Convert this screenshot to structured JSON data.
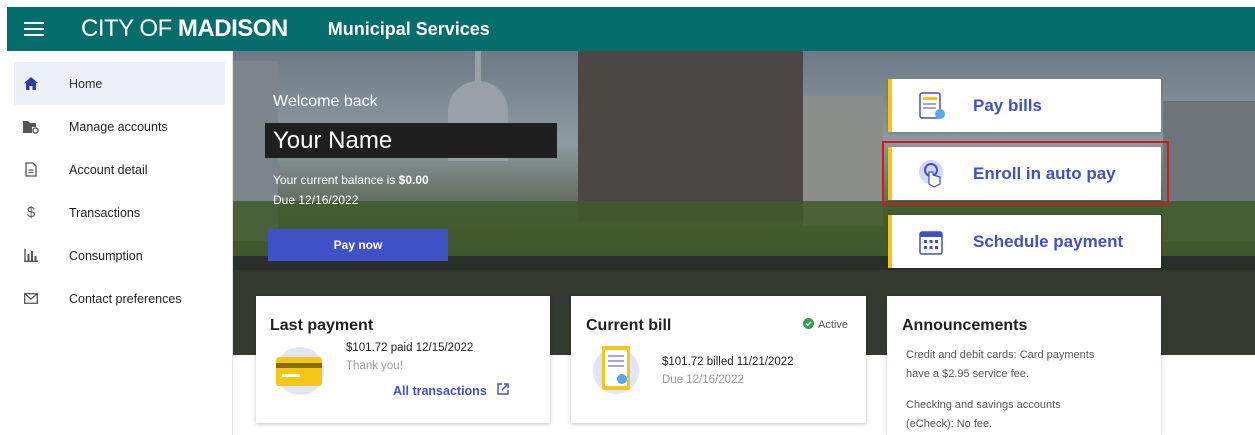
{
  "header": {
    "brand_light": "CITY OF ",
    "brand_bold": "MADISON",
    "subtitle": "Municipal Services"
  },
  "sidebar": {
    "items": [
      {
        "label": "Home",
        "icon": "home-icon"
      },
      {
        "label": "Manage accounts",
        "icon": "folder-settings-icon"
      },
      {
        "label": "Account detail",
        "icon": "document-icon"
      },
      {
        "label": "Transactions",
        "icon": "dollar-icon"
      },
      {
        "label": "Consumption",
        "icon": "bar-chart-icon"
      },
      {
        "label": "Contact preferences",
        "icon": "envelope-icon"
      }
    ]
  },
  "hero": {
    "welcome": "Welcome back",
    "name": "Your Name",
    "balance_prefix": "Your current balance is ",
    "balance_amount": "$0.00",
    "due": "Due 12/16/2022",
    "pay_now": "Pay now"
  },
  "quick_actions": [
    {
      "label": "Pay bills",
      "icon": "bill-icon"
    },
    {
      "label": "Enroll in auto pay",
      "icon": "autopay-hand-icon"
    },
    {
      "label": "Schedule payment",
      "icon": "calendar-icon"
    }
  ],
  "last_payment": {
    "title": "Last payment",
    "line1": "$101.72 paid 12/15/2022",
    "line2": "Thank you!",
    "link": "All transactions"
  },
  "current_bill": {
    "title": "Current bill",
    "status": "Active",
    "line1": "$101.72 billed 11/21/2022",
    "line2": "Due 12/16/2022"
  },
  "announcements": {
    "title": "Announcements",
    "p1_line1": "Credit and debit cards: Card payments",
    "p1_line2": "have a $2.95 service fee.",
    "p2_line1": "Checking and savings accounts",
    "p2_line2": "(eCheck): No fee."
  },
  "colors": {
    "header_bg": "#056d6b",
    "accent": "#3f51c4",
    "quick_action_border": "#f5c518",
    "highlight": "#cc1b1b",
    "active_green": "#2e9e4f"
  }
}
